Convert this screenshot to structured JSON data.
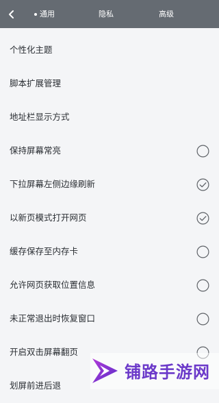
{
  "header": {
    "tabs": [
      {
        "label": "通用",
        "active": true
      },
      {
        "label": "隐私",
        "active": false
      },
      {
        "label": "高级",
        "active": false
      }
    ],
    "back_icon": "chevron-left-icon"
  },
  "settings": {
    "items": [
      {
        "label": "个性化主题"
      },
      {
        "label": "脚本扩展管理"
      },
      {
        "label": "地址栏显示方式"
      },
      {
        "label": "保持屏幕常亮",
        "checked": false
      },
      {
        "label": "下拉屏幕左侧边缘刷新",
        "checked": true
      },
      {
        "label": "以新页模式打开网页",
        "checked": true
      },
      {
        "label": "缓存保存至内存卡",
        "checked": false
      },
      {
        "label": "允许网页获取位置信息",
        "checked": false
      },
      {
        "label": "未正常退出时恢复窗口",
        "checked": false
      },
      {
        "label": "开启双击屏幕翻页",
        "checked": false
      },
      {
        "label": "划屏前进后退"
      }
    ]
  },
  "watermark": {
    "text": "铺路手游网"
  },
  "colors": {
    "header_bg": "#656b72",
    "page_bg": "#f4f5f7",
    "check": "#5f6368",
    "watermark": "#6b39c9"
  }
}
